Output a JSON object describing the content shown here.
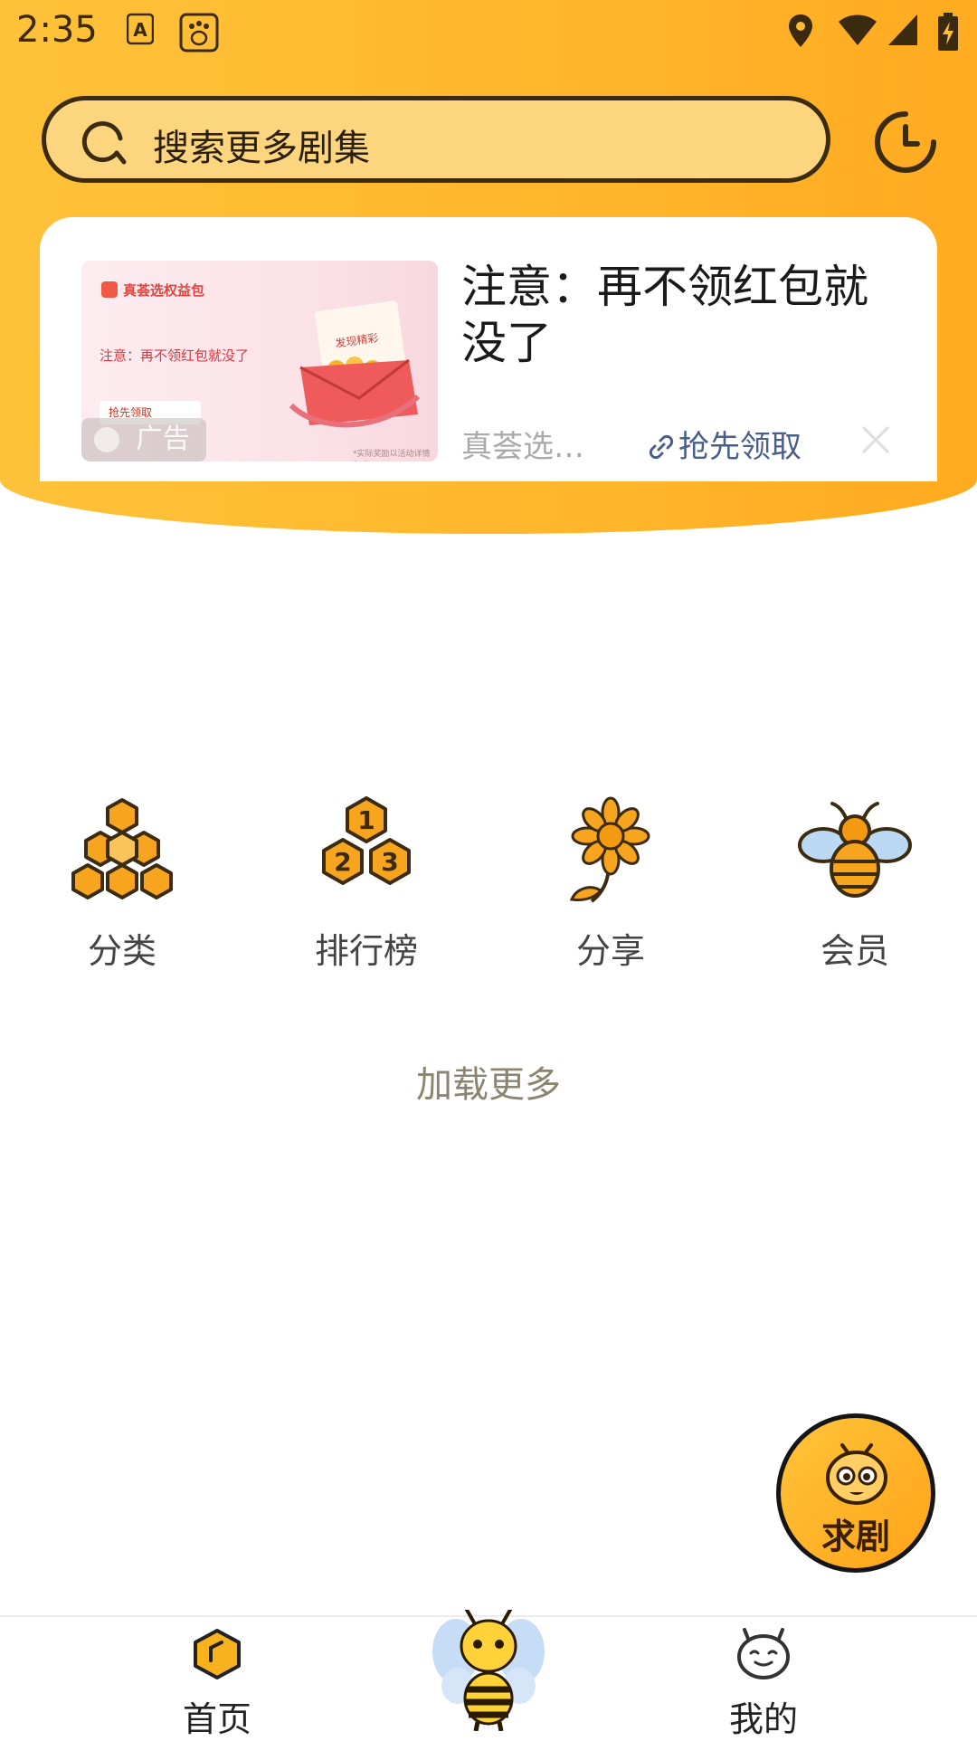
{
  "status_bar": {
    "time": "2:35",
    "icons": [
      "a-notification-icon",
      "baidu-paw-icon",
      "location-icon",
      "wifi-icon",
      "cell-signal-icon",
      "battery-charging-icon"
    ]
  },
  "search": {
    "placeholder": "搜索更多剧集",
    "icon": "search-icon",
    "history_icon": "clock-icon"
  },
  "ad": {
    "title": "注意：再不领红包就没了",
    "source": "真荟选…",
    "action": "抢先领取",
    "badge": "广告",
    "image": {
      "brand": "真荟选权益包",
      "text": "注意：再不领红包就没了",
      "button": "抢先领取",
      "stamp": "发现精彩",
      "fineprint": "*实际奖励以活动详情为准"
    }
  },
  "menu": [
    {
      "label": "分类",
      "icon": "honeycomb-icon"
    },
    {
      "label": "排行榜",
      "icon": "ranking-icon"
    },
    {
      "label": "分享",
      "icon": "flower-icon"
    },
    {
      "label": "会员",
      "icon": "bee-icon"
    }
  ],
  "load_more": "加载更多",
  "fab": {
    "label": "求剧",
    "icon": "bee-face-icon"
  },
  "tabs": [
    {
      "label": "首页",
      "icon": "home-hexagon-icon"
    },
    {
      "label": "",
      "icon": "bee-mascot-icon"
    },
    {
      "label": "我的",
      "icon": "profile-face-icon"
    }
  ],
  "colors": {
    "header": "#ffb62b",
    "outline": "#3b2b10",
    "honey": "#f7a51e",
    "link": "#4a5e8a"
  }
}
